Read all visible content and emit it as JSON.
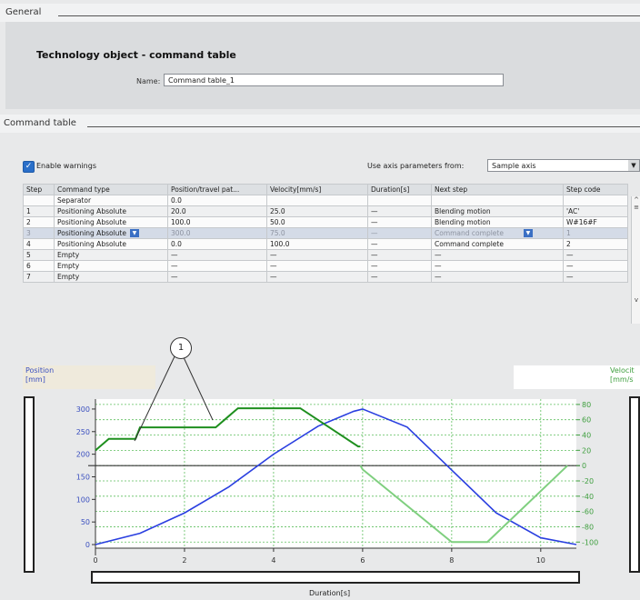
{
  "general": {
    "label": "General",
    "title": "Technology object - command table",
    "name_label": "Name:",
    "name_value": "Command table_1"
  },
  "command_table": {
    "label": "Command table",
    "enable_warnings_label": "Enable warnings",
    "axis_params_label": "Use axis parameters from:",
    "axis_params_value": "Sample axis",
    "columns": [
      "Step",
      "Command type",
      "Position/travel pat...",
      "Velocity[mm/s]",
      "Duration[s]",
      "Next step",
      "Step code"
    ],
    "rows": [
      [
        "",
        "Separator",
        "0.0",
        "",
        "",
        "",
        ""
      ],
      [
        "1",
        "Positioning Absolute",
        "20.0",
        "25.0",
        "—",
        "Blending motion",
        "'AC'"
      ],
      [
        "2",
        "Positioning Absolute",
        "100.0",
        "50.0",
        "—",
        "Blending motion",
        "W#16#F"
      ],
      [
        "3",
        "Positioning Absolute",
        "300.0",
        "75.0",
        "—",
        "Command complete",
        "1"
      ],
      [
        "4",
        "Positioning Absolute",
        "0.0",
        "100.0",
        "—",
        "Command complete",
        "2"
      ],
      [
        "5",
        "Empty",
        "—",
        "—",
        "—",
        "—",
        "—"
      ],
      [
        "6",
        "Empty",
        "—",
        "—",
        "—",
        "—",
        "—"
      ],
      [
        "7",
        "Empty",
        "—",
        "—",
        "—",
        "—",
        "—"
      ]
    ],
    "selected_row": 3
  },
  "callout": "1",
  "chart_data": {
    "type": "line",
    "x_label": "Duration[s]",
    "y_left_label": "Position\n[mm]",
    "y_right_label": "Velocit\n[mm/s",
    "x_ticks": [
      0,
      2,
      4,
      6,
      8,
      10
    ],
    "y_left_ticks": [
      0,
      50,
      100,
      150,
      200,
      250,
      300
    ],
    "y_right_ticks": [
      80,
      60,
      40,
      20,
      0,
      -20,
      -40,
      -60,
      -80,
      -100
    ],
    "x_range": [
      0,
      10.8
    ],
    "y_left_range": [
      -8,
      322
    ],
    "y_right_range": [
      -108,
      87
    ],
    "grid": true,
    "series": [
      {
        "color": "#2a3fe0",
        "axis": "left",
        "x": [
          0,
          1,
          2,
          3,
          4,
          5,
          5.8,
          6,
          7,
          8,
          9,
          10,
          10.8
        ],
        "y": [
          0,
          25,
          70,
          128,
          200,
          262,
          295,
          300,
          260,
          165,
          70,
          15,
          0
        ]
      },
      {
        "color": "#1e8f1e",
        "axis": "right",
        "x": [
          0,
          0.3,
          0.9,
          1.0,
          1.6,
          2.7,
          3.2,
          4.6,
          5.9,
          5.95
        ],
        "y": [
          20,
          35,
          35,
          50,
          50,
          50,
          75,
          75,
          25,
          25
        ]
      },
      {
        "color": "#7fcf7f",
        "axis": "right",
        "x": [
          5.95,
          6.0,
          8.0,
          8.8,
          10.6
        ],
        "y": [
          0,
          -5,
          -100,
          -100,
          0
        ]
      }
    ]
  }
}
